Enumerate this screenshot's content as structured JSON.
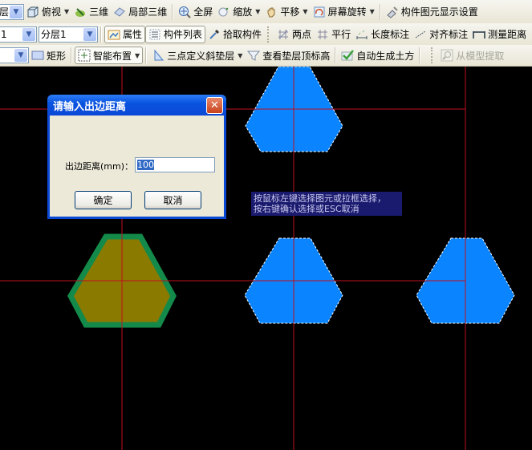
{
  "toolbar": {
    "row1": {
      "layer_combo_fragment": "层",
      "top_view": "俯视",
      "three_d": "三维",
      "partial_3d": "局部三维",
      "fullscreen": "全屏",
      "zoom": "缩放",
      "pan": "平移",
      "screen_rotate": "屏幕旋转",
      "display_settings": "构件图元显示设置"
    },
    "row2": {
      "floor_combo_value": "1",
      "sublayer_combo_value": "分层1",
      "properties": "属性",
      "component_list": "构件列表",
      "pick_component": "拾取构件",
      "two_points": "两点",
      "parallel": "平行",
      "length_dim": "长度标注",
      "align_dim": "对齐标注",
      "measure_distance": "测量距离"
    },
    "row3": {
      "combo_value": "",
      "rectangle": "矩形",
      "smart_layout": "智能布置",
      "three_point_slope": "三点定义斜垫层",
      "view_cushion_top": "查看垫层顶标高",
      "auto_earthwork": "自动生成土方",
      "extract_from_model": "从模型提取"
    }
  },
  "dialog": {
    "title": "请输入出边距离",
    "field_label": "出边距离(mm)：",
    "field_value": "100",
    "ok": "确定",
    "cancel": "取消"
  },
  "hint": {
    "line1": "按鼠标左键选择图元或拉框选择，",
    "line2": "按右键确认选择或ESC取消"
  },
  "colors": {
    "canvas_bg": "#000000",
    "axis_line": "#c0101e",
    "element_fill": "#0a84ff",
    "selected_fill": "#8a7a00",
    "selected_outline": "#148a4a"
  },
  "canvas": {
    "elements": [
      {
        "name": "cushion-element",
        "state": "unselected"
      },
      {
        "name": "cushion-element",
        "state": "selected"
      },
      {
        "name": "cushion-element",
        "state": "unselected"
      },
      {
        "name": "cushion-element",
        "state": "unselected"
      }
    ]
  }
}
